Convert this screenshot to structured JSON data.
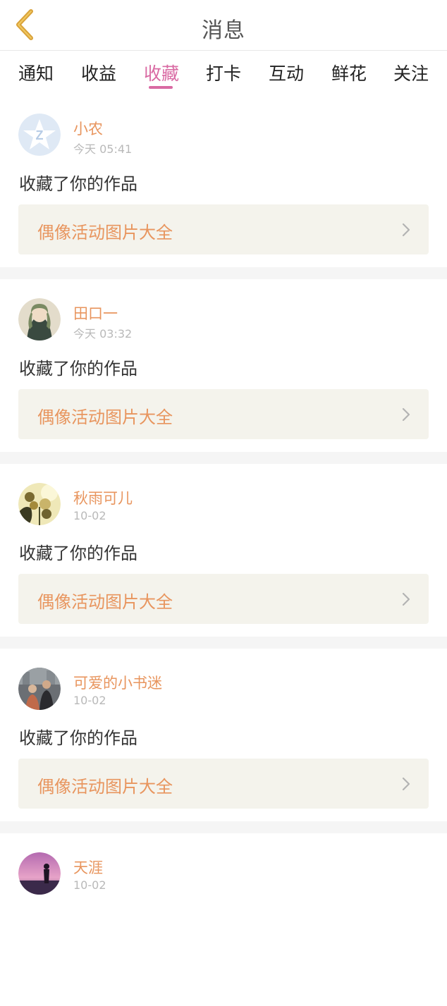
{
  "header": {
    "title": "消息",
    "back_icon": "chevron-left-icon"
  },
  "tabs": [
    {
      "label": "通知",
      "active": false
    },
    {
      "label": "收益",
      "active": false
    },
    {
      "label": "收藏",
      "active": true
    },
    {
      "label": "打卡",
      "active": false
    },
    {
      "label": "互动",
      "active": false
    },
    {
      "label": "鲜花",
      "active": false
    },
    {
      "label": "关注",
      "active": false
    }
  ],
  "colors": {
    "accent": "#d96aa3",
    "name": "#e8955e",
    "time": "#b9b9b9",
    "card_bg": "#f4f3ec",
    "back_icon": "#d9a23a"
  },
  "messages": [
    {
      "user": "小农",
      "time": "今天 05:41",
      "action": "收藏了你的作品",
      "work_title": "偶像活动图片大全",
      "avatar": "q-logo-avatar"
    },
    {
      "user": "田口一",
      "time": "今天 03:32",
      "action": "收藏了你的作品",
      "work_title": "偶像活动图片大全",
      "avatar": "anime-girl-avatar"
    },
    {
      "user": "秋雨可儿",
      "time": "10-02",
      "action": "收藏了你的作品",
      "work_title": "偶像活动图片大全",
      "avatar": "flowers-avatar"
    },
    {
      "user": "可爱的小书迷",
      "time": "10-02",
      "action": "收藏了你的作品",
      "work_title": "偶像活动图片大全",
      "avatar": "people-photo-avatar"
    },
    {
      "user": "天涯",
      "time": "10-02",
      "action": "",
      "work_title": "",
      "avatar": "sunset-silhouette-avatar"
    }
  ]
}
